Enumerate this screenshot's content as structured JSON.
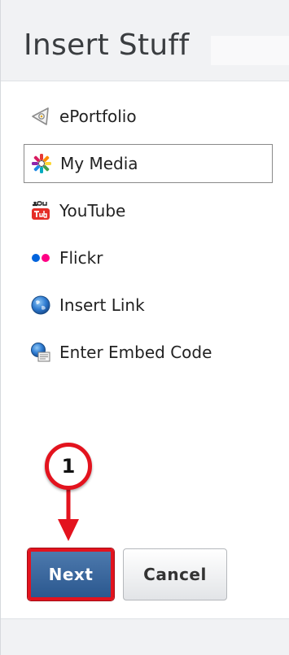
{
  "header": {
    "title": "Insert Stuff"
  },
  "items": [
    {
      "label": "ePortfolio",
      "icon": "eportfolio-icon",
      "selected": false
    },
    {
      "label": "My Media",
      "icon": "my-media-icon",
      "selected": true
    },
    {
      "label": "YouTube",
      "icon": "youtube-icon",
      "selected": false
    },
    {
      "label": "Flickr",
      "icon": "flickr-icon",
      "selected": false
    },
    {
      "label": "Insert Link",
      "icon": "globe-icon",
      "selected": false
    },
    {
      "label": "Enter Embed Code",
      "icon": "embed-code-icon",
      "selected": false
    }
  ],
  "buttons": {
    "next": "Next",
    "cancel": "Cancel"
  },
  "annotation": {
    "step": "1"
  },
  "colors": {
    "highlight": "#e3131e",
    "primary_button": "#2b588f",
    "header_bg": "#f1f2f4"
  }
}
